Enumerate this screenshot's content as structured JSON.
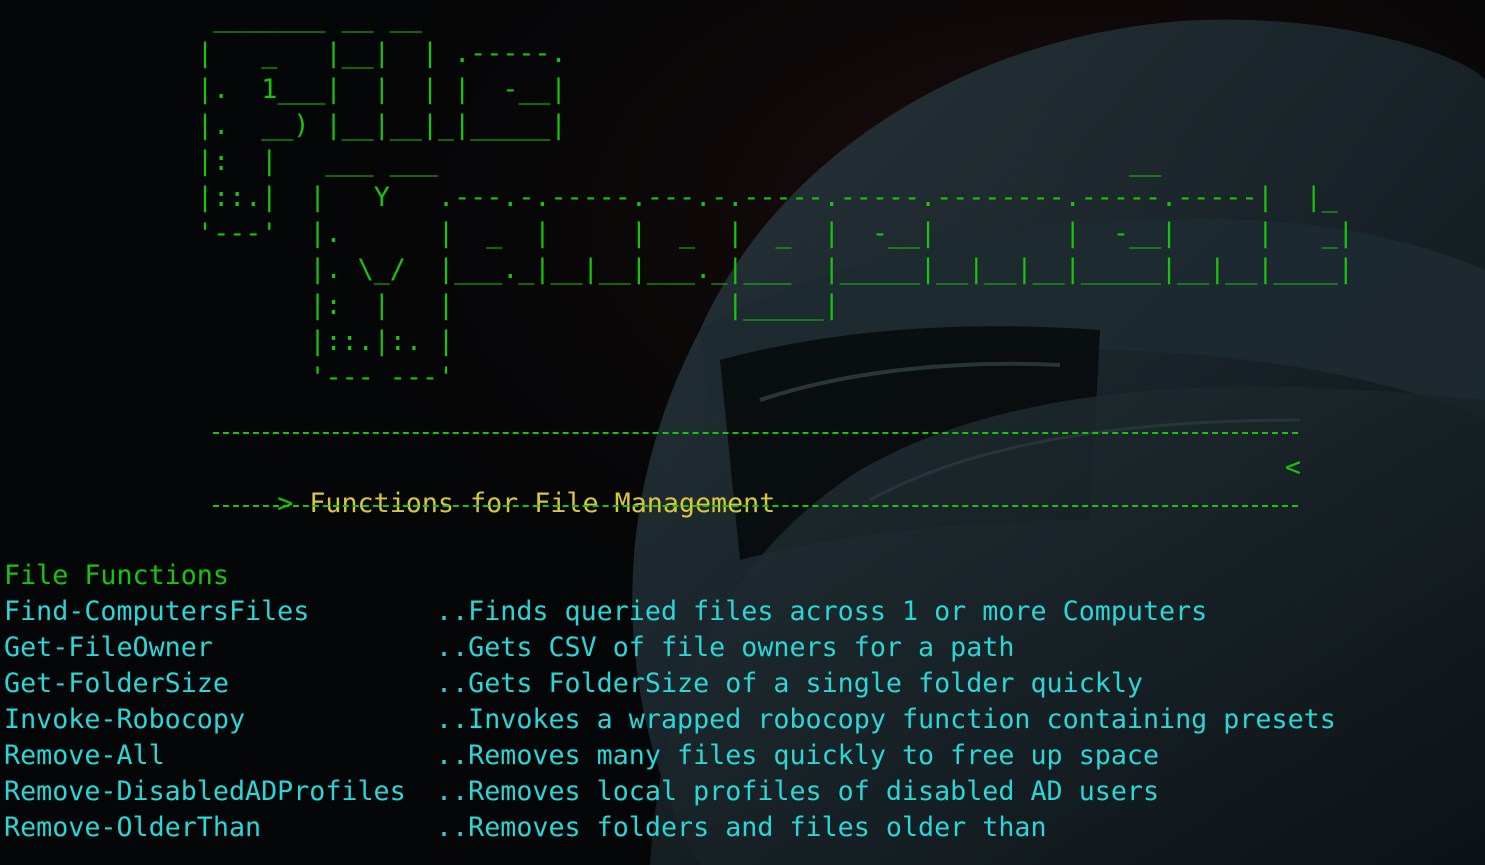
{
  "colors": {
    "background": "#050607",
    "ascii_art": "#19c40c",
    "banner_title": "#d9c63a",
    "function_text": "#2ad6d6",
    "section_title": "#19c40c"
  },
  "ascii_art": " _______ __ __\n|   _   |__|  | .-----.\n|.  1___|  |  | |  -__|\n|.  __) |__|__|_|_____|\n|:  |   ___ ___                                           __\n|::.|  |   Y   .---.-.-----.---.-.-----.-----.--------.-----.-----|  |_\n'---'  |.      |  _  |     |  _  |  _  |  -__|        |  -__|     |   _|\n       |. \\_/  |___._|__|__|___._|___  |_____|__|__|__|_____|__|__|____|\n       |:  |   |                 |_____|\n       |::.|:. |\n       '--- ---'",
  "banner": {
    "left_marker": ">",
    "title": "Functions for File Management",
    "right_marker": "<"
  },
  "section": {
    "title": "File Functions"
  },
  "functions": [
    {
      "name": "Find-ComputersFiles",
      "description": "..Finds queried files across 1 or more Computers"
    },
    {
      "name": "Get-FileOwner",
      "description": "..Gets CSV of file owners for a path"
    },
    {
      "name": "Get-FolderSize",
      "description": "..Gets FolderSize of a single folder quickly"
    },
    {
      "name": "Invoke-Robocopy",
      "description": "..Invokes a wrapped robocopy function containing presets"
    },
    {
      "name": "Remove-All",
      "description": "..Removes many files quickly to free up space"
    },
    {
      "name": "Remove-DisabledADProfiles",
      "description": "..Removes local profiles of disabled AD users"
    },
    {
      "name": "Remove-OlderThan",
      "description": "..Removes folders and files older than"
    }
  ]
}
